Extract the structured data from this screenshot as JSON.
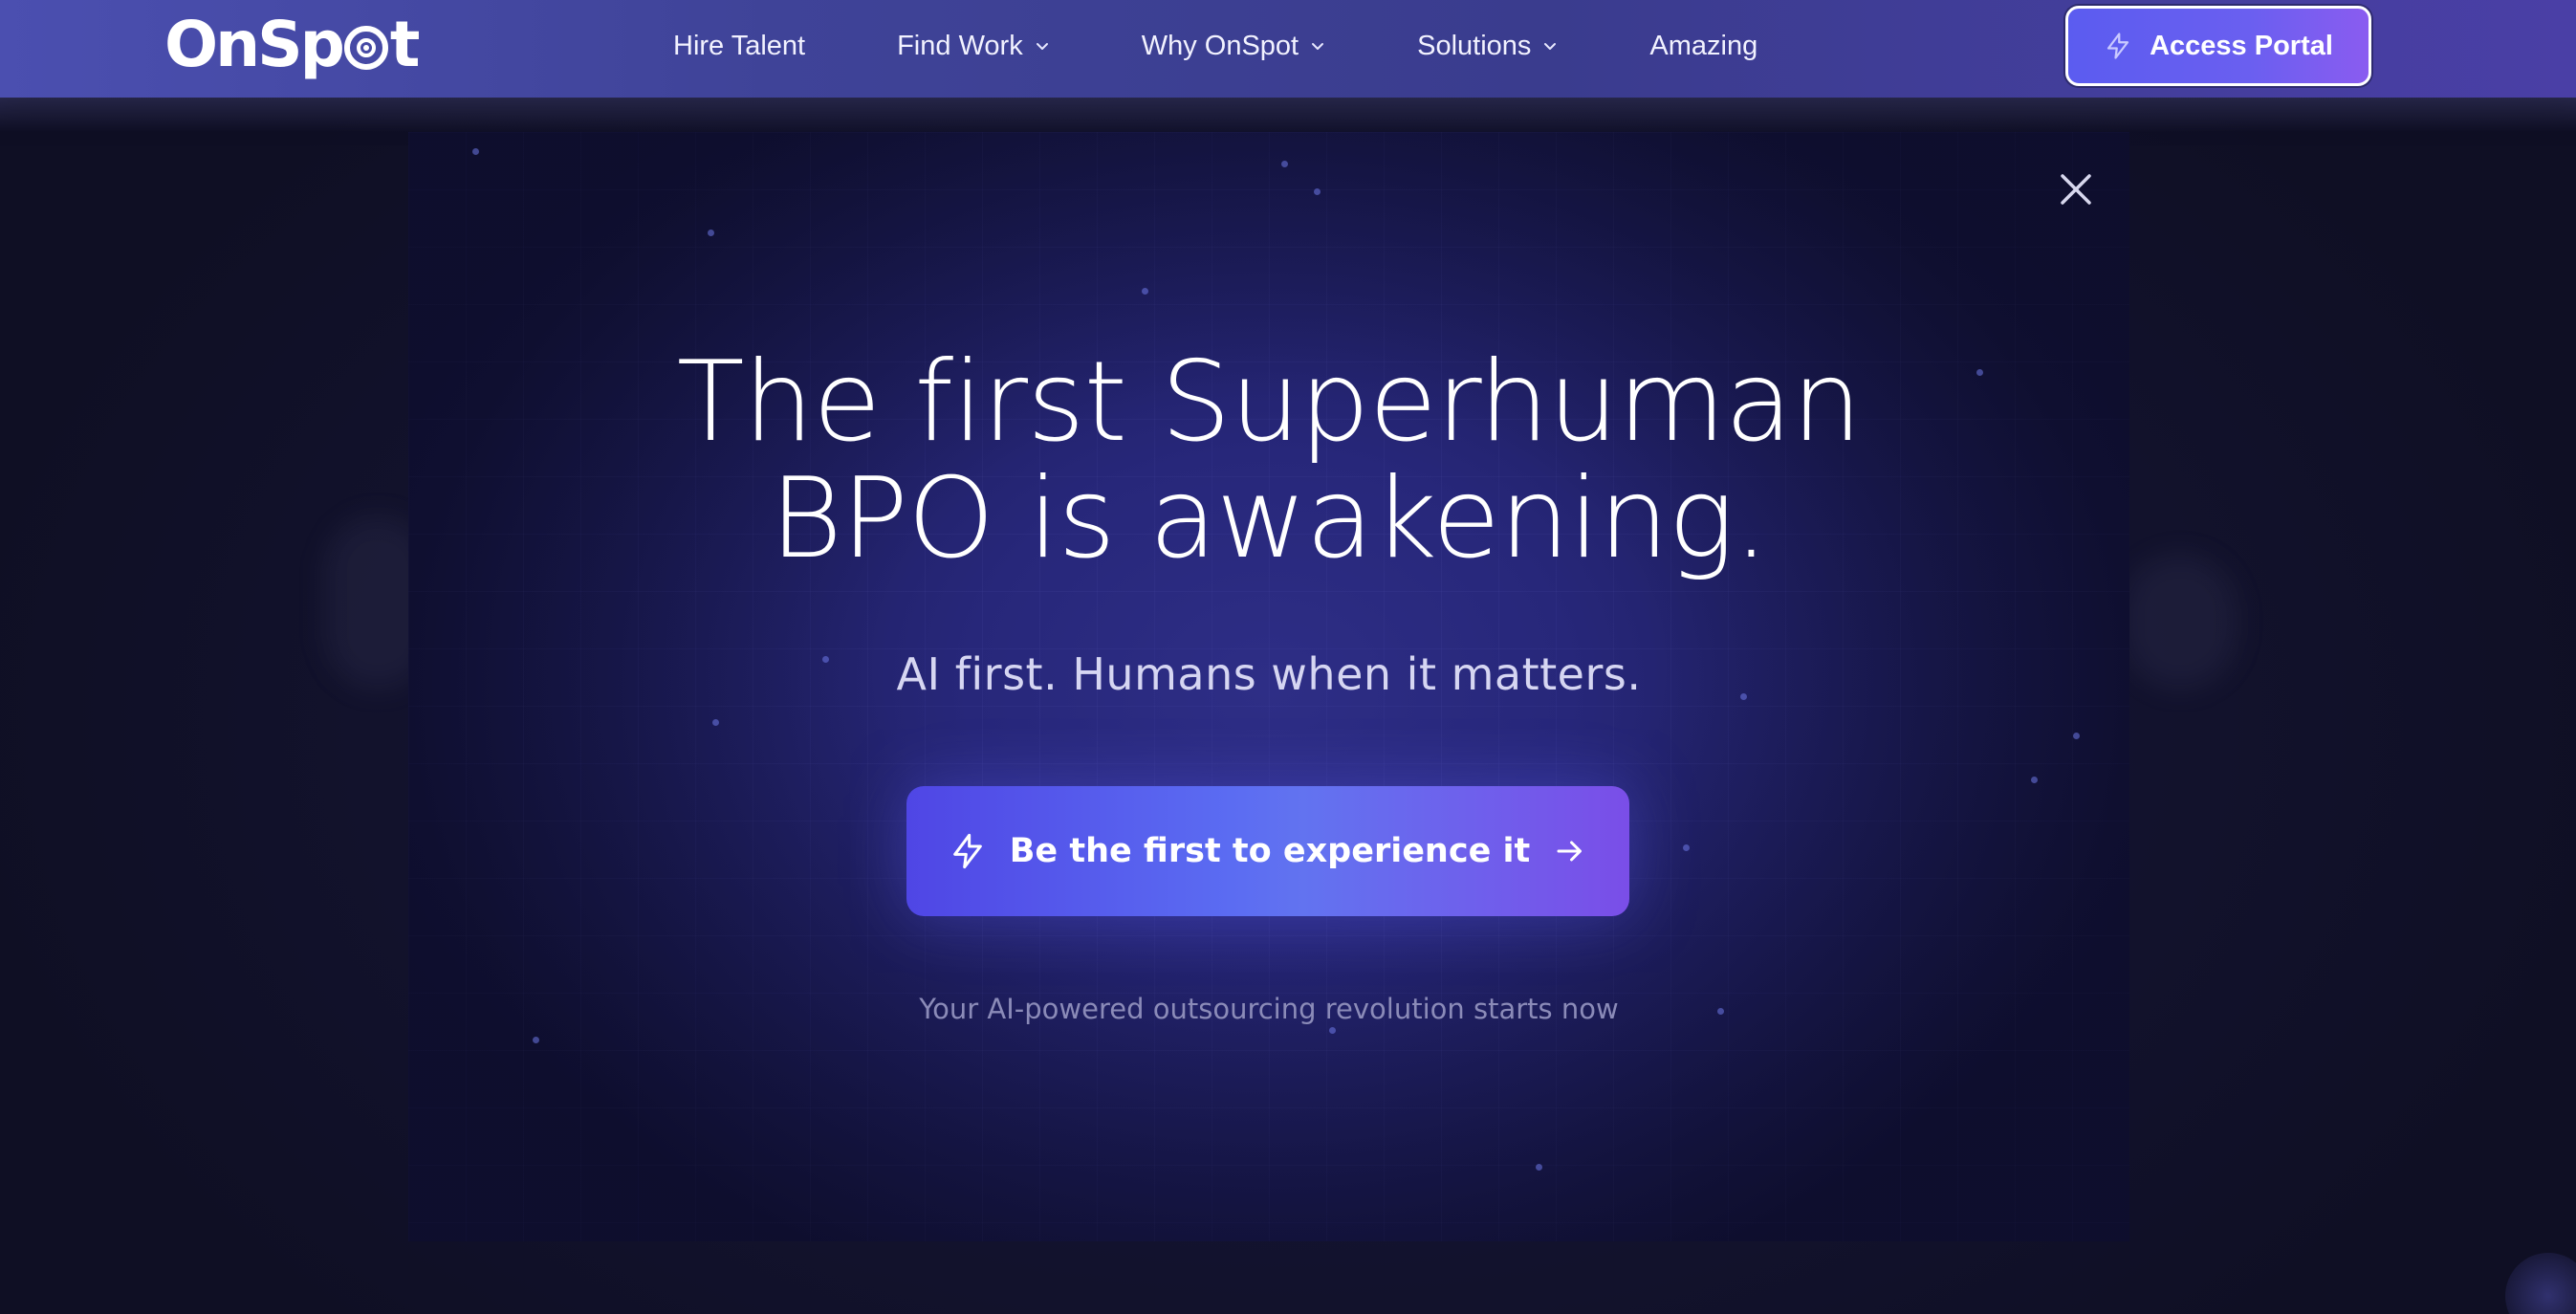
{
  "nav": {
    "brand": "OnSp",
    "brand_tail": "t",
    "links": [
      {
        "label": "Hire Talent",
        "has_dropdown": false
      },
      {
        "label": "Find Work",
        "has_dropdown": true
      },
      {
        "label": "Why OnSpot",
        "has_dropdown": true
      },
      {
        "label": "Solutions",
        "has_dropdown": true
      },
      {
        "label": "Amazing",
        "has_dropdown": false
      }
    ],
    "portal_button": "Access Portal"
  },
  "modal": {
    "headline_line1": "The first Superhuman",
    "headline_line2": "BPO is awakening.",
    "subheadline": "AI first. Humans when it matters.",
    "cta_label": "Be the first to experience it",
    "tagline": "Your AI-powered outsourcing revolution starts now"
  },
  "colors": {
    "nav_bg": "#3f4398",
    "accent": "#5b5cf0",
    "modal_bg": "#27277a",
    "cta_start": "#4f46e5",
    "cta_end": "#7a4ee8"
  },
  "icons": {
    "portal_button": "lightning-icon",
    "cta_lead": "lightning-icon",
    "cta_trail": "arrow-right-icon",
    "close": "close-icon",
    "dropdown": "chevron-down-icon"
  }
}
